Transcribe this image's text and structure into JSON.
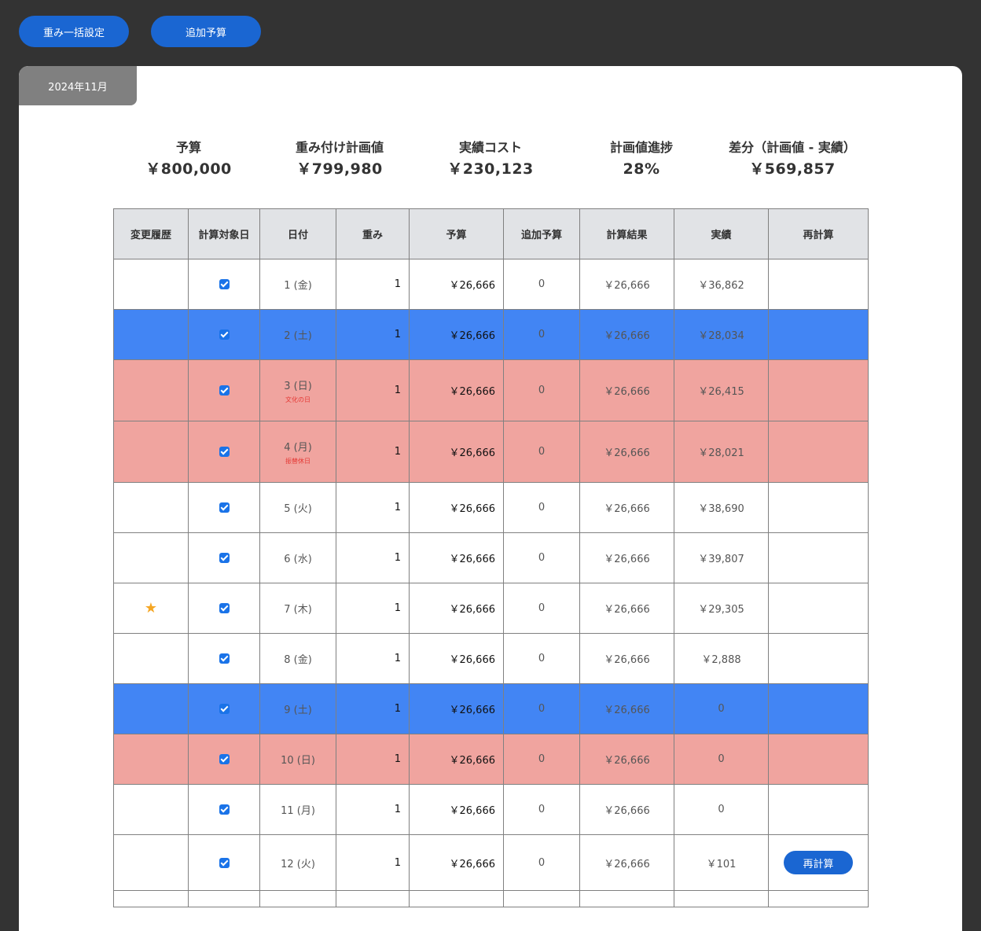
{
  "toolbar": {
    "bulk_weight_label": "重み一括設定",
    "add_budget_label": "追加予算"
  },
  "month_tab": "2024年11月",
  "summary": [
    {
      "label": "予算",
      "value": "￥800,000"
    },
    {
      "label": "重み付け計画値",
      "value": "￥799,980"
    },
    {
      "label": "実績コスト",
      "value": "￥230,123"
    },
    {
      "label": "計画値進捗",
      "value": "28%"
    },
    {
      "label": "差分（計画値 - 実績）",
      "value": "￥569,857"
    }
  ],
  "table": {
    "headers": [
      "変更履歴",
      "計算対象日",
      "日付",
      "重み",
      "予算",
      "追加予算",
      "計算結果",
      "実績",
      "再計算"
    ],
    "rows": [
      {
        "date": "1 (金)",
        "holiday": "",
        "weight": "1",
        "budget": "￥26,666",
        "add": "0",
        "result": "￥26,666",
        "actual": "￥36,862"
      },
      {
        "date": "2 (土)",
        "holiday": "",
        "weight": "1",
        "budget": "￥26,666",
        "add": "0",
        "result": "￥26,666",
        "actual": "￥28,034"
      },
      {
        "date": "3 (日)",
        "holiday": "文化の日",
        "weight": "1",
        "budget": "￥26,666",
        "add": "0",
        "result": "￥26,666",
        "actual": "￥26,415"
      },
      {
        "date": "4 (月)",
        "holiday": "振替休日",
        "weight": "1",
        "budget": "￥26,666",
        "add": "0",
        "result": "￥26,666",
        "actual": "￥28,021"
      },
      {
        "date": "5 (火)",
        "holiday": "",
        "weight": "1",
        "budget": "￥26,666",
        "add": "0",
        "result": "￥26,666",
        "actual": "￥38,690"
      },
      {
        "date": "6 (水)",
        "holiday": "",
        "weight": "1",
        "budget": "￥26,666",
        "add": "0",
        "result": "￥26,666",
        "actual": "￥39,807"
      },
      {
        "date": "7 (木)",
        "holiday": "",
        "weight": "1",
        "budget": "￥26,666",
        "add": "0",
        "result": "￥26,666",
        "actual": "￥29,305"
      },
      {
        "date": "8 (金)",
        "holiday": "",
        "weight": "1",
        "budget": "￥26,666",
        "add": "0",
        "result": "￥26,666",
        "actual": "￥2,888"
      },
      {
        "date": "9 (土)",
        "holiday": "",
        "weight": "1",
        "budget": "￥26,666",
        "add": "0",
        "result": "￥26,666",
        "actual": "0"
      },
      {
        "date": "10 (日)",
        "holiday": "",
        "weight": "1",
        "budget": "￥26,666",
        "add": "0",
        "result": "￥26,666",
        "actual": "0"
      },
      {
        "date": "11 (月)",
        "holiday": "",
        "weight": "1",
        "budget": "￥26,666",
        "add": "0",
        "result": "￥26,666",
        "actual": "0"
      },
      {
        "date": "12 (火)",
        "holiday": "",
        "weight": "1",
        "budget": "￥26,666",
        "add": "0",
        "result": "￥26,666",
        "actual": "￥101"
      }
    ],
    "recalc_label": "再計算"
  },
  "colors": {
    "button_blue": "#1a66d2",
    "saturday_row": "#4285f4",
    "holiday_row": "#f0a49f",
    "star": "#f5a623"
  },
  "icons": {
    "history_star": "star-icon",
    "checkbox": "checkbox-checked-icon"
  }
}
